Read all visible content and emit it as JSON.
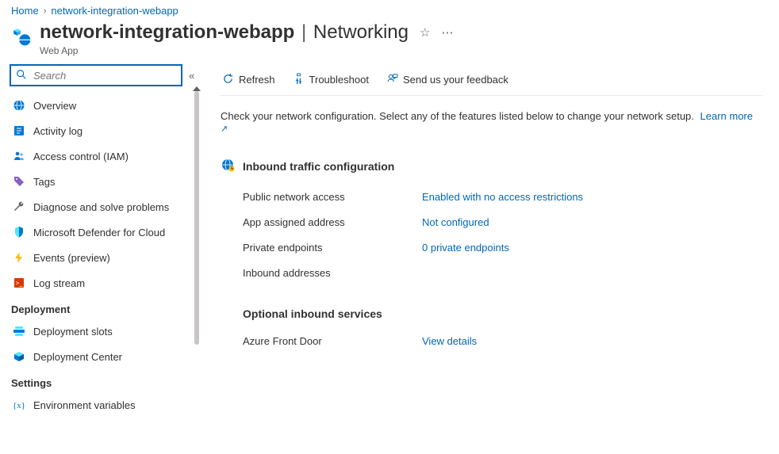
{
  "breadcrumb": {
    "home": "Home",
    "resource": "network-integration-webapp"
  },
  "header": {
    "title": "network-integration-webapp",
    "section": "Networking",
    "subtitle": "Web App"
  },
  "search": {
    "placeholder": "Search"
  },
  "sidebar": {
    "items": [
      {
        "label": "Overview"
      },
      {
        "label": "Activity log"
      },
      {
        "label": "Access control (IAM)"
      },
      {
        "label": "Tags"
      },
      {
        "label": "Diagnose and solve problems"
      },
      {
        "label": "Microsoft Defender for Cloud"
      },
      {
        "label": "Events (preview)"
      },
      {
        "label": "Log stream"
      }
    ],
    "groups": [
      {
        "label": "Deployment",
        "items": [
          {
            "label": "Deployment slots"
          },
          {
            "label": "Deployment Center"
          }
        ]
      },
      {
        "label": "Settings",
        "items": [
          {
            "label": "Environment variables"
          }
        ]
      }
    ]
  },
  "toolbar": {
    "refresh": "Refresh",
    "troubleshoot": "Troubleshoot",
    "feedback": "Send us your feedback"
  },
  "intro": {
    "text": "Check your network configuration. Select any of the features listed below to change your network setup.",
    "learn": "Learn more"
  },
  "inbound": {
    "title": "Inbound traffic configuration",
    "rows": [
      {
        "key": "Public network access",
        "val": "Enabled with no access restrictions",
        "link": true
      },
      {
        "key": "App assigned address",
        "val": "Not configured",
        "link": true
      },
      {
        "key": "Private endpoints",
        "val": "0 private endpoints",
        "link": true
      },
      {
        "key": "Inbound addresses",
        "val": "",
        "link": false
      }
    ]
  },
  "optional": {
    "title": "Optional inbound services",
    "rows": [
      {
        "key": "Azure Front Door",
        "val": "View details",
        "link": true
      }
    ]
  }
}
